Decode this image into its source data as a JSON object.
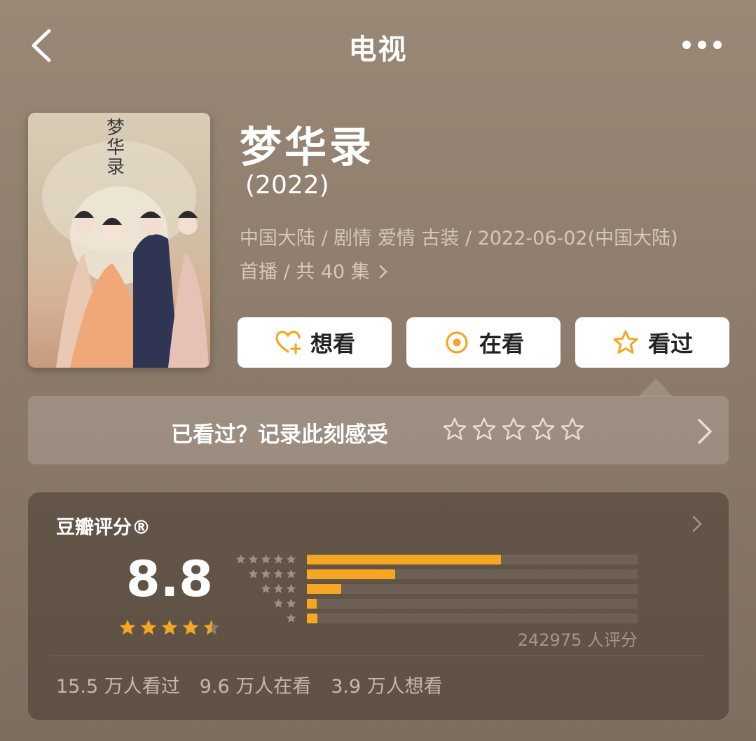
{
  "header": {
    "title": "电视"
  },
  "show": {
    "title": "梦华录",
    "year": "(2022)",
    "meta_line1": "中国大陆 / 剧情 爱情 古装 / 2022-06-02(中国大陆)",
    "meta_line2": "首播 / 共 40 集"
  },
  "actions": {
    "want_label": "想看",
    "watching_label": "在看",
    "watched_label": "看过"
  },
  "record": {
    "prompt": "已看过？记录此刻感受"
  },
  "rating": {
    "title": "豆瓣评分®",
    "score": "8.8",
    "star_value": 4.5,
    "distribution": [
      {
        "stars": 5,
        "fraction": 0.587
      },
      {
        "stars": 4,
        "fraction": 0.267
      },
      {
        "stars": 3,
        "fraction": 0.103
      },
      {
        "stars": 2,
        "fraction": 0.03
      },
      {
        "stars": 1,
        "fraction": 0.032
      }
    ],
    "raters": "242975 人评分"
  },
  "stats": {
    "watched": "15.5 万人看过",
    "watching": "9.6 万人在看",
    "want": "3.9 万人想看"
  },
  "colors": {
    "accent": "#f5a623",
    "card": "#ffffff",
    "background": "#8f7d6d"
  }
}
